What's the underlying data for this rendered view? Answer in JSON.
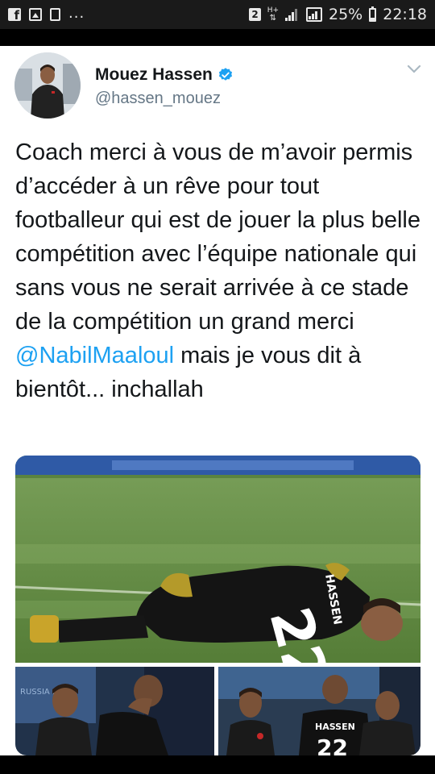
{
  "status_bar": {
    "sim_badge": "2",
    "network_type": "H+",
    "battery": "25%",
    "time": "22:18",
    "dots": "..."
  },
  "tweet": {
    "display_name": "Mouez Hassen",
    "handle": "@hassen_mouez",
    "verified_icon": "verified-badge-icon",
    "text_before": "Coach merci à vous de m’avoir permis d’accéder à un rêve pour tout footballeur qui est de jouer la plus belle compétition avec l’équipe nationale qui sans vous ne serait arrivée à ce stade de la compétition un grand merci ",
    "mention": "@NabilMaaloul",
    "text_after": " mais je vous dit à bientôt... inchallah"
  },
  "media": {
    "main_jersey_number": "22",
    "main_jersey_name": "HASSEN",
    "photo_br_jersey_name": "HASSEN",
    "photo_br_jersey_number": "22",
    "photo_bl_banner": "RUSSIA 2018"
  },
  "colors": {
    "link": "#1da1f2",
    "text": "#14171a",
    "secondary": "#657786",
    "pitch": "#5f8b3f"
  }
}
